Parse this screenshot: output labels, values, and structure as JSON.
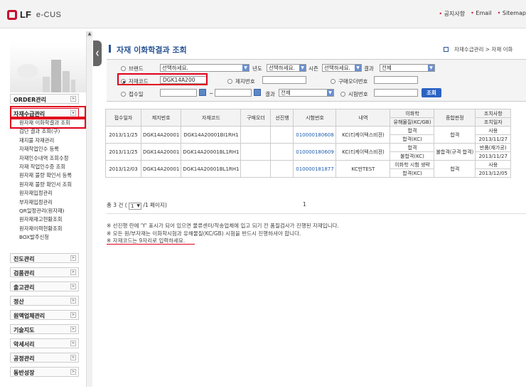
{
  "header": {
    "logo_text": "LF",
    "app_name": "e-CUS",
    "links": [
      "공지사항",
      "Email",
      "Sitemap"
    ]
  },
  "sidebar": {
    "menus": [
      {
        "label": "ORDER관리"
      },
      {
        "label": "자재수급관리"
      },
      {
        "label": "진도관리"
      },
      {
        "label": "검품관리"
      },
      {
        "label": "출고관리"
      },
      {
        "label": "정산"
      },
      {
        "label": "원액업체관리"
      },
      {
        "label": "기술지도"
      },
      {
        "label": "악세서리"
      },
      {
        "label": "공정관리"
      },
      {
        "label": "동반성장"
      }
    ],
    "submenu": [
      "원자재 이화학결과 조회",
      "검단 결과 조회(구)",
      "재지불 자재관리",
      "자재작업인수 등록",
      "자재인수내역 조회수정",
      "자재 작업인수증 조회",
      "원자재 불량 확인서 등록",
      "원자재 불량 확인서 조회",
      "원자재입정관리",
      "부자재입정관리",
      "QR일정관리(원자재)",
      "원자재재고현황조회",
      "원자재이력현황조회",
      "BOX발주신청"
    ]
  },
  "page": {
    "title": "자재 이화학결과 조회",
    "breadcrumb": "자재수급관리 > 자재 이화"
  },
  "search": {
    "brand_label": "브랜드",
    "brand_value": "선택하세요.",
    "year_label": "년도",
    "year_value": "선택하세요.",
    "season_label": "시즌",
    "season_value": "선택하세요.",
    "result_label": "결과",
    "result_value": "전체",
    "code_label": "자재코드",
    "code_value": "DGK14A200",
    "jaeji_label": "제지번호",
    "order_label": "구매오더번호",
    "date_label": "접수일",
    "date_sep": "~",
    "result2_label": "결과",
    "result2_value": "전체",
    "test_label": "시험번호",
    "search_button": "조회"
  },
  "table": {
    "headers": {
      "date": "접수일자",
      "jaeji": "제지번호",
      "code": "자재코드",
      "order": "구매오더",
      "sunjin": "선진행",
      "test": "시험번호",
      "content": "내역",
      "chem": "이화학",
      "chem_sub": "유해물질(KC/GB)",
      "overall": "종합판정",
      "action": "조치사항",
      "action_sub": "조치일자"
    },
    "rows": [
      {
        "date": "2013/11/25",
        "jaeji": "DGK14A20001",
        "code": "DGK14A20001BI1RH1",
        "order": "",
        "sunjin": "",
        "test": "010000180608",
        "content": "KC(티케이텍스비젼)",
        "chem1": "합격",
        "chem2": "합격(KC)",
        "overall": "합격",
        "action1": "사용",
        "action2": "2013/11/27"
      },
      {
        "date": "2013/11/25",
        "jaeji": "DGK14A20001",
        "code": "DGK14A20001BL1RH1",
        "order": "",
        "sunjin": "",
        "test": "010000180609",
        "content": "KC(티케이텍스비젼)",
        "chem1": "합격",
        "chem2": "불합격(KC)",
        "overall": "불합격(규격 합격)",
        "action1": "반품(재가공)",
        "action2": "2013/11/27"
      },
      {
        "date": "2013/12/03",
        "jaeji": "DGK14A20001",
        "code": "DGK14A20001BL1RH1",
        "order": "",
        "sunjin": "",
        "test": "010000181877",
        "content": "KC만TEST",
        "chem1": "이화학 시험 생략",
        "chem2": "합격(KC)",
        "overall": "합격",
        "action1": "사용",
        "action2": "2013/12/05"
      }
    ]
  },
  "pager": {
    "total": "총 3 건 (",
    "page_sel": "1",
    "suffix": "/1 페이지)",
    "current": "1"
  },
  "notes": [
    "※ 선진행 란에 'Y' 표시가 되어 있으면 물류센터/작송업체에 입고 되기 전 품질검사가 진행된 자재입니다.",
    "※ 모든 원/부자재는 이화학시험과 유해물질(KC/GB) 시험을 반드시 진행하셔야 합니다.",
    "※ 자재코드는 9자리로 입력하세요."
  ]
}
